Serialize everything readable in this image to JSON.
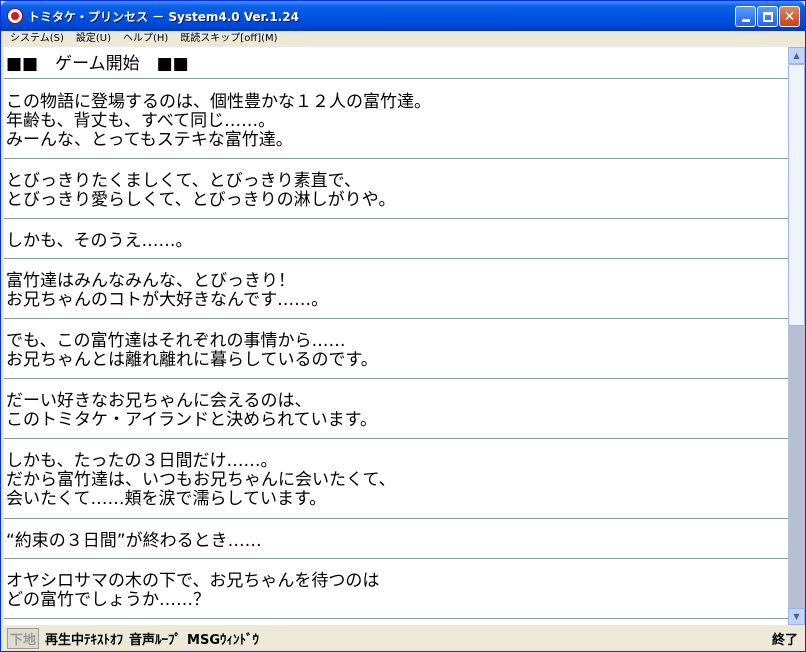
{
  "window": {
    "title": "トミタケ・プリンセス － System4.0 Ver.1.24"
  },
  "menu": {
    "items": [
      {
        "label": "システム(S)"
      },
      {
        "label": "設定(U)"
      },
      {
        "label": "ヘルプ(H)"
      },
      {
        "label": "既読スキップ[off](M)"
      }
    ]
  },
  "content": {
    "heading": "■■　ゲーム開始　■■",
    "paragraphs": [
      {
        "lines": [
          "この物語に登場するのは、個性豊かな１２人の富竹達。",
          "年齢も、背丈も、すべて同じ……。",
          "みーんな、とってもステキな富竹達。"
        ]
      },
      {
        "lines": [
          "とびっきりたくましくて、とびっきり素直で、",
          "とびっきり愛らしくて、とびっきりの淋しがりや。"
        ]
      },
      {
        "lines": [
          "しかも、そのうえ……。"
        ]
      },
      {
        "lines": [
          "富竹達はみんなみんな、とびっきり！",
          "お兄ちゃんのコトが大好きなんです……。"
        ]
      },
      {
        "lines": [
          "でも、この富竹達はそれぞれの事情から……",
          "お兄ちゃんとは離れ離れに暮らしているのです。"
        ]
      },
      {
        "lines": [
          "だーい好きなお兄ちゃんに会えるのは、",
          "このトミタケ・アイランドと決められています。"
        ]
      },
      {
        "lines": [
          "しかも、たったの３日間だけ……。",
          "だから富竹達は、いつもお兄ちゃんに会いたくて、",
          "会いたくて……頬を涙で濡らしています。"
        ]
      },
      {
        "lines": [
          "“約束の３日間”が終わるとき……"
        ]
      },
      {
        "lines": [
          "オヤシロサマの木の下で、お兄ちゃんを待つのは",
          "どの富竹でしょうか……？"
        ]
      }
    ]
  },
  "status": {
    "shitaji": "下地",
    "playing": "再生中",
    "text_off": "ﾃｷｽﾄｵﾌ",
    "voice_loop": "音声ﾙｰﾌﾟ",
    "msg_window": "MSGｳｨﾝﾄﾞｳ",
    "end": "終了"
  },
  "icons": {
    "app": "app-logo-icon",
    "minimize": "minimize-icon",
    "maximize": "maximize-icon",
    "close": "close-icon",
    "scroll_up": "scroll-up-arrow-icon",
    "scroll_down": "scroll-down-arrow-icon"
  },
  "colors": {
    "titlebar": "#0054e3",
    "divider": "#7f9a9a",
    "close_button": "#c8401a"
  }
}
